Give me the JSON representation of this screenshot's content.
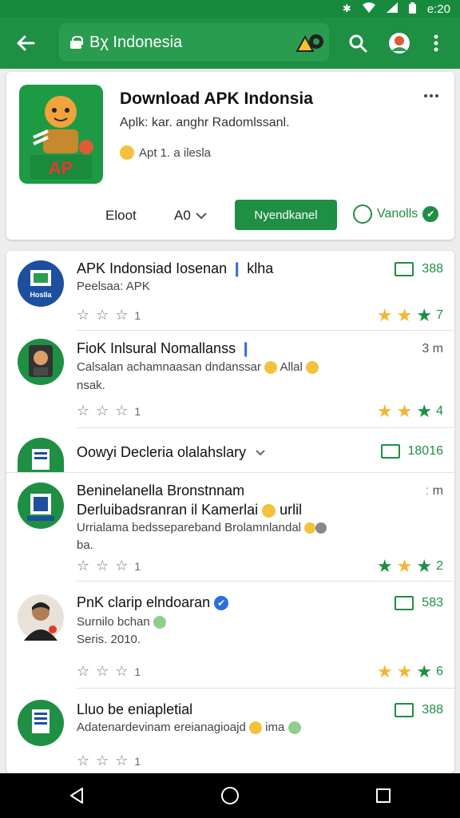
{
  "status_bar": {
    "time": "e:20",
    "icons": [
      "bluetooth-icon",
      "wifi-icon",
      "signal-icon",
      "battery-icon"
    ]
  },
  "toolbar": {
    "url": "Indonesia",
    "url_prefix": "Bχ"
  },
  "hero": {
    "title": "Download APK Indonsia",
    "subtitle": "Aplk: kar. anghr Radomlssanl.",
    "meta": "Apt 1. a ilesla",
    "icon_text": "AP",
    "action_left": "Eloot",
    "action_mid": "A0",
    "install_label": "Nyendkanel",
    "verify_label": "Vanolls"
  },
  "items": [
    {
      "title": "APK Indonsiad Iosenan",
      "title_tail": "klha",
      "sub": "Peelsaa: APK",
      "count": "388",
      "stars_count": "7",
      "social_count": "1",
      "avatar_text": "Hoslla"
    },
    {
      "title": "FioK Inlsural Nomallanss",
      "sub": "Calsalan achamnaasan dndanssar",
      "sub_tail": "Allal",
      "sub2": "nsak.",
      "time": "3 m",
      "stars_count": "4",
      "social_count": "1"
    },
    {
      "title": "Oowyi Decleria olalahslary",
      "count": "18016"
    },
    {
      "title": "Beninelanella Bronstnnam",
      "title2": "Derluibadsranran il Kamerlai",
      "title2_tail": "urlil",
      "sub": "Urrialama bedssepareband Brolamnlandal",
      "sub2": "ba.",
      "time": "ː m",
      "stars_count": "2",
      "social_count": "1"
    },
    {
      "title": "PnK clarip elndoaran",
      "sub": "Surnilo bchan",
      "sub2": "Seris. 2010.",
      "count": "583",
      "stars_count": "6",
      "social_count": "1"
    },
    {
      "title": "Lluo be eniapletial",
      "sub": "Adatenardevinam ereianagioajd",
      "sub_tail": "ima",
      "count": "388",
      "social_count": "1"
    }
  ],
  "colors": {
    "brand_green": "#1e8f43",
    "star_gold": "#f2b632"
  }
}
